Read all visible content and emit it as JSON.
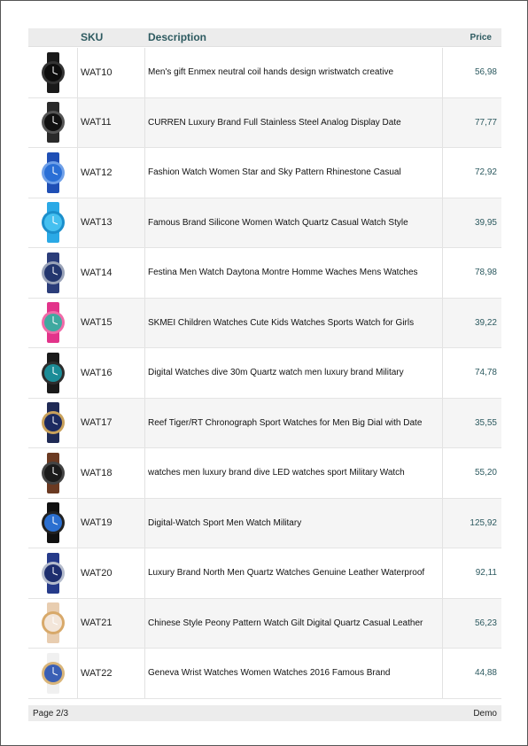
{
  "table": {
    "headers": {
      "sku": "SKU",
      "description": "Description",
      "price": "Price"
    },
    "rows": [
      {
        "sku": "WAT10",
        "description": "Men's gift Enmex neutral coil hands design wristwatch creative",
        "price": "56,98",
        "image": "black-sport-watch",
        "strap": "#1a1a1a",
        "dial": "#0d0d0d",
        "bezel": "#333333"
      },
      {
        "sku": "WAT11",
        "description": "CURREN Luxury Brand Full Stainless Steel Analog Display Date",
        "price": "77,77",
        "image": "black-steel-watch",
        "strap": "#2a2a2a",
        "dial": "#111111",
        "bezel": "#555555"
      },
      {
        "sku": "WAT12",
        "description": "Fashion Watch Women Star and Sky Pattern Rhinestone Casual",
        "price": "72,92",
        "image": "blue-star-watch",
        "strap": "#1f4fb5",
        "dial": "#2a6fd6",
        "bezel": "#6fa0e8"
      },
      {
        "sku": "WAT13",
        "description": "Famous Brand Silicone Women Watch Quartz Casual Watch Style",
        "price": "39,95",
        "image": "cyan-silicone-watch",
        "strap": "#2aa9e6",
        "dial": "#45c0f0",
        "bezel": "#1b8fcc"
      },
      {
        "sku": "WAT14",
        "description": "Festina Men Watch Daytona Montre Homme Waches Mens Watches",
        "price": "78,98",
        "image": "navy-watch",
        "strap": "#2b3d7a",
        "dial": "#23366e",
        "bezel": "#9aa3b8"
      },
      {
        "sku": "WAT15",
        "description": "SKMEI Children Watches Cute Kids Watches Sports Watch for Girls",
        "price": "39,22",
        "image": "pink-kids-watch",
        "strap": "#e2338a",
        "dial": "#3fa9a0",
        "bezel": "#f06aa8"
      },
      {
        "sku": "WAT16",
        "description": "Digital Watches dive 30m Quartz watch men luxury brand Military",
        "price": "74,78",
        "image": "teal-dive-watch",
        "strap": "#1a1a1a",
        "dial": "#1b8c97",
        "bezel": "#2d2d2d"
      },
      {
        "sku": "WAT17",
        "description": "Reef Tiger/RT Chronograph Sport Watches for Men Big Dial with Date",
        "price": "35,55",
        "image": "gold-chrono-watch",
        "strap": "#1f2a55",
        "dial": "#1c2a60",
        "bezel": "#c9a15b"
      },
      {
        "sku": "WAT18",
        "description": "watches men luxury brand dive LED watches sport Military Watch",
        "price": "55,20",
        "image": "brown-leather-watch",
        "strap": "#6b3a22",
        "dial": "#1a1a1a",
        "bezel": "#444444"
      },
      {
        "sku": "WAT19",
        "description": "Digital-Watch Sport Men Watch Military",
        "price": "125,92",
        "image": "digital-sport-watch",
        "strap": "#111111",
        "dial": "#2b6fd0",
        "bezel": "#222222"
      },
      {
        "sku": "WAT20",
        "description": "Luxury Brand North Men Quartz Watches Genuine Leather Waterproof",
        "price": "92,11",
        "image": "blue-leather-watch",
        "strap": "#263b8a",
        "dial": "#1d2e6e",
        "bezel": "#b5bccc"
      },
      {
        "sku": "WAT21",
        "description": "Chinese Style Peony Pattern Watch Gilt Digital Quartz Casual Leather",
        "price": "56,23",
        "image": "peony-watch",
        "strap": "#e8cdb0",
        "dial": "#f3e6da",
        "bezel": "#d8a96a"
      },
      {
        "sku": "WAT22",
        "description": "Geneva Wrist Watches Women Watches 2016 Famous Brand",
        "price": "44,88",
        "image": "white-moon-watch",
        "strap": "#f0f0f0",
        "dial": "#3a5fb5",
        "bezel": "#d9b57a"
      }
    ]
  },
  "footer": {
    "page": "Page 2/3",
    "brand": "Demo"
  }
}
